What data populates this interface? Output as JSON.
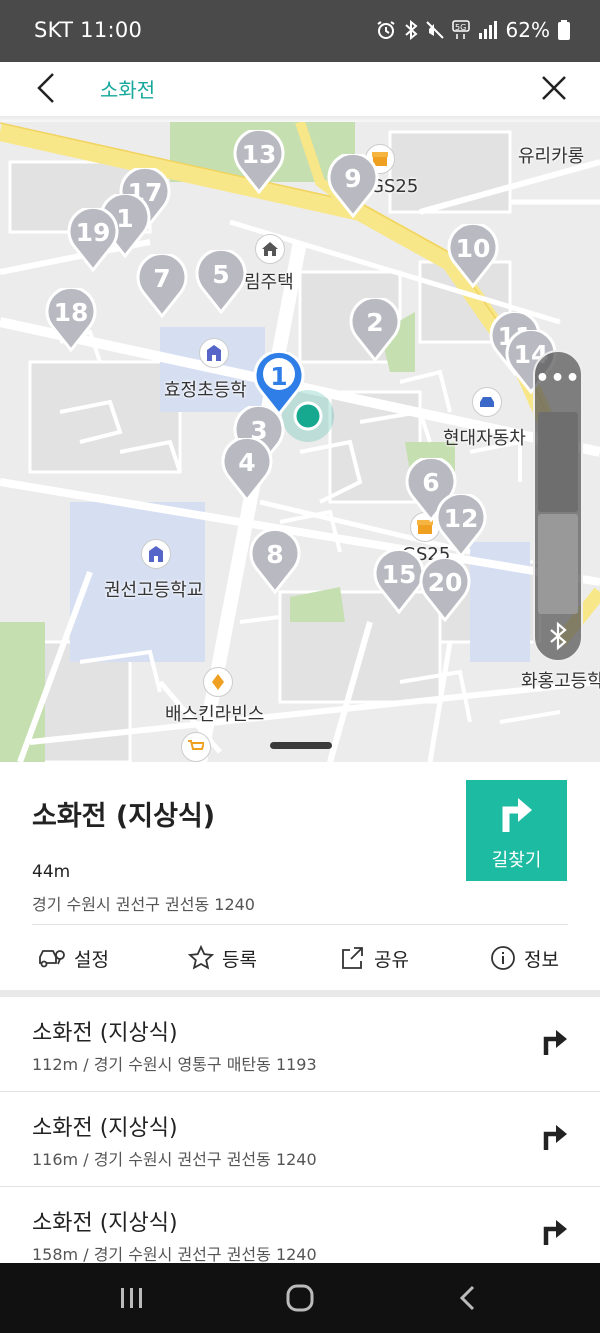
{
  "status_bar": {
    "carrier_time": "SKT 11:00",
    "battery": "62%",
    "icons": [
      "alarm-icon",
      "bluetooth-icon",
      "mute-icon",
      "5g-icon",
      "signal-icon",
      "battery-icon"
    ]
  },
  "header": {
    "title": "소화전",
    "back_icon": "chevron-left-icon",
    "close_icon": "close-icon"
  },
  "map": {
    "labels": {
      "yuri": "유리카롱",
      "gs25_top": "GS25",
      "rim": "림주택",
      "hyojeong": "효정초등학",
      "hyundai": "현대자동차",
      "gs25_mid": "GS25",
      "gwonseon": "권선고등학교",
      "baskin": "배스킨라빈스",
      "hwahong": "화홍고등학"
    },
    "pins": [
      "13",
      "9",
      "17",
      "1",
      "19",
      "10",
      "7",
      "5",
      "18",
      "2",
      "11",
      "14",
      "1",
      "3",
      "4",
      "6",
      "12",
      "8",
      "15",
      "20"
    ],
    "zoom_more_label": "•••",
    "colors": {
      "pin_gray": "#b9b9c2",
      "pin_blue": "#2f7ee8",
      "location_dot": "#17a890",
      "main_road": "#f8e788",
      "park": "#c5dfb0",
      "school": "#d6dff2"
    }
  },
  "detail": {
    "name": "소화전 (지상식)",
    "distance": "44m",
    "address": "경기 수원시 권선구 권선동 1240",
    "route_label": "길찾기",
    "accent": "#1ebba3",
    "actions": [
      {
        "label": "설정",
        "icon": "car-location-icon"
      },
      {
        "label": "등록",
        "icon": "star-icon"
      },
      {
        "label": "공유",
        "icon": "share-icon"
      },
      {
        "label": "정보",
        "icon": "info-icon"
      }
    ]
  },
  "results": [
    {
      "name": "소화전 (지상식)",
      "detail": "112m / 경기 수원시 영통구 매탄동 1193"
    },
    {
      "name": "소화전 (지상식)",
      "detail": "116m / 경기 수원시 권선구 권선동 1240"
    },
    {
      "name": "소화전 (지상식)",
      "detail": "158m / 경기 수원시 권선구 권선동 1240"
    }
  ],
  "navbar": {
    "buttons": [
      "recent-apps-icon",
      "home-icon",
      "back-icon"
    ]
  }
}
